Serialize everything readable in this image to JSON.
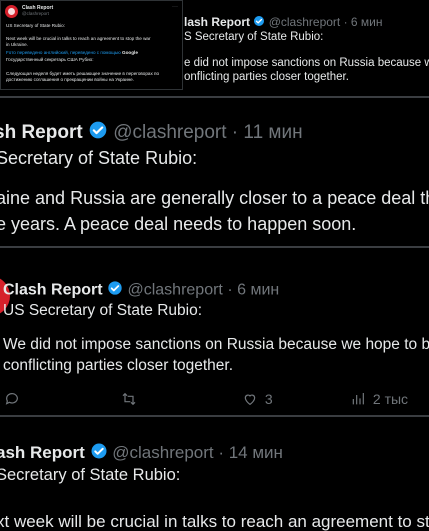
{
  "thumb": {
    "name": "Clash Report",
    "handle": "@clashreport",
    "more": "···",
    "line_title": "US Secretary of State Rubio:",
    "line_b1": "Next week will be crucial in talks to reach an agreement to stop the war",
    "line_b2": "in Ukraine.",
    "translate_label": "Fото переведено английский, переведено с помощью",
    "translate_brand": "Google",
    "ru_title": "Государственный секретарь США Рубио:",
    "ru_b1": "Следующая неделя будет иметь решающее значение в переговорах по",
    "ru_b2": "достижению соглашения о прекращении войны на Украине."
  },
  "card1": {
    "name_partial": "lash Report",
    "handle_time": "@clashreport · 6 мин",
    "sub_partial": "S Secretary of State Rubio:",
    "body1_partial": "e did not impose sanctions on Russia because we hope t",
    "body2_partial": "onflicting parties closer together."
  },
  "card2": {
    "name_partial": "sh Report",
    "handle_time": "@clashreport · 11 мин",
    "sub_partial": "Secretary of State Rubio:",
    "body1_partial": "aine and Russia are generally closer to a peace deal than",
    "body2_partial": "e years. A peace deal needs to happen soon."
  },
  "card3": {
    "name": "Clash Report",
    "handle_time": "@clashreport · 6 мин",
    "sub": "US Secretary of State Rubio:",
    "body1_partial": "We did not impose sanctions on Russia because we hope to br",
    "body2": "conflicting parties closer together.",
    "likes": "3",
    "views": "2 тыс"
  },
  "card4": {
    "name_partial": "ash Report",
    "handle_time": "@clashreport · 14 мин",
    "sub_partial": "Secretary of State Rubio:",
    "body1_partial": "xt week will be crucial in talks to reach an agreement to stop"
  },
  "colors": {
    "background": "#000000",
    "text": "#e7e9ea",
    "muted": "#71767b",
    "verified": "#1d9bf0",
    "avatar": "#d6202b"
  }
}
